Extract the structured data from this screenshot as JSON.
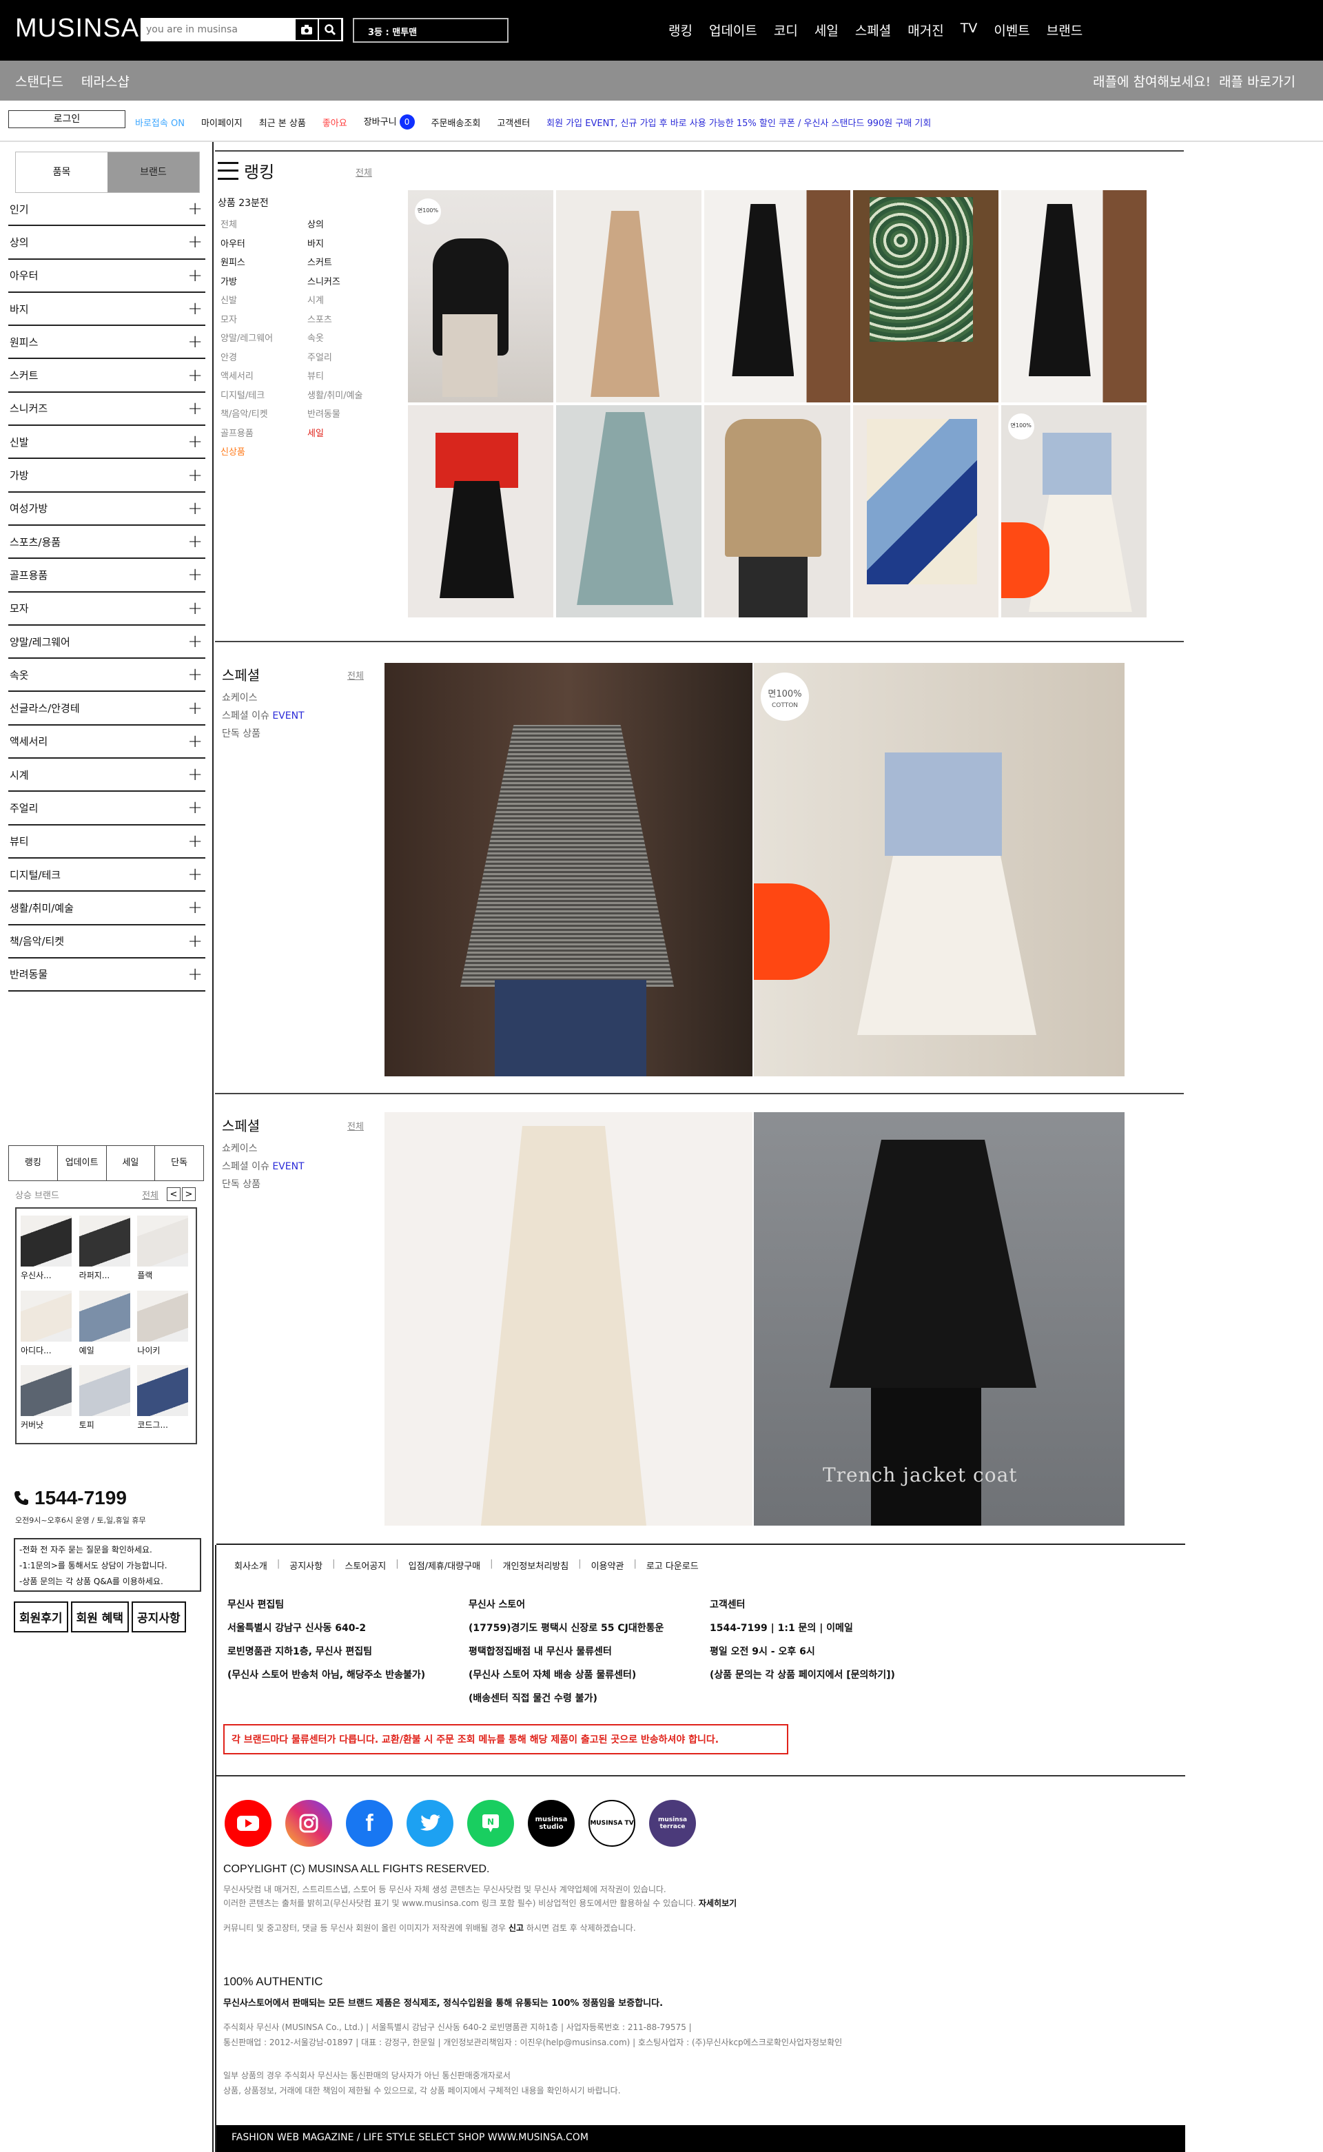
{
  "header": {
    "logo": "MUSINSA",
    "search_placeholder": "you are in musinsa",
    "rank_box": "3등 : 맨투맨",
    "nav": [
      "랭킹",
      "업데이트",
      "코디",
      "세일",
      "스페셜",
      "매거진",
      "TV",
      "이벤트",
      "브랜드"
    ]
  },
  "subbar": {
    "left": [
      "스탠다드",
      "테라스샵"
    ],
    "right": [
      "래플에 참여해보세요!",
      "래플 바로가기"
    ]
  },
  "thirdbar": {
    "login": "로그인",
    "links": [
      "바로접속 ON",
      "마이페이지",
      "최근 본 상품",
      "좋아요",
      "장바구니",
      "주문배송조회",
      "고객센터"
    ],
    "cart_count": "0",
    "promo": "회원 가입 EVENT, 신규 가입 후 바로 사용 가능한 15% 할인 쿠폰 / 우신사 스탠다드 990원 구매 기회"
  },
  "sidebar": {
    "tabs": [
      "품목",
      "브랜드"
    ],
    "categories": [
      "인기",
      "상의",
      "아우터",
      "바지",
      "원피스",
      "스커트",
      "스니커즈",
      "신발",
      "가방",
      "여성가방",
      "스포츠/용품",
      "골프용품",
      "모자",
      "양말/레그웨어",
      "속옷",
      "선글라스/안경테",
      "액세서리",
      "시계",
      "주얼리",
      "뷰티",
      "디지털/테크",
      "생활/취미/예술",
      "책/음악/티켓",
      "반려동물"
    ],
    "mini_tabs": [
      "랭킹",
      "업데이트",
      "세일",
      "단독"
    ],
    "brand_head": "상승 브랜드",
    "brand_all": "전체",
    "brands": [
      "우신사...",
      "라퍼지...",
      "플랙",
      "아디다...",
      "예일",
      "나이키",
      "커버낫",
      "토피",
      "코드그..."
    ],
    "phone": "1544-7199",
    "phone_sub": "오전9시~오후6시 운영 / 토,일,휴일 휴무",
    "qbox": [
      "-전화 전 자주 묻는 질문을 확인하세요.",
      "-1:1문의>를 통해서도 상담이 가능합니다.",
      "-상품 문의는 각 상품 Q&A를 이용하세요."
    ],
    "buttons": [
      "회원후기",
      "회원 혜택",
      "공지사항"
    ]
  },
  "ranking": {
    "title": "랭킹",
    "all": "전체",
    "sub": "상품 23분전",
    "cats_left": [
      "전체",
      "아우터",
      "원피스",
      "가방",
      "신발",
      "모자",
      "양말/레그웨어",
      "안경",
      "액세서리",
      "디지털/테크",
      "책/음악/티켓",
      "골프용품",
      "신상품"
    ],
    "cats_right": [
      "상의",
      "바지",
      "스커트",
      "스니커즈",
      "시계",
      "스포츠",
      "속옷",
      "주얼리",
      "뷰티",
      "생활/취미/예술",
      "반려동물",
      "세일"
    ],
    "cotton_label": "면100%"
  },
  "special1": {
    "title": "스페셜",
    "all": "전체",
    "items": [
      "쇼케이스",
      "스페셜 이슈",
      "EVENT",
      "단독 상품"
    ],
    "cotton": "면100%",
    "cotton_en": "COTTON"
  },
  "special2": {
    "title": "스페셜",
    "all": "전체",
    "items": [
      "쇼케이스",
      "스페셜 이슈",
      "EVENT",
      "단독 상품"
    ],
    "caption": "Trench jacket coat"
  },
  "footer": {
    "links": [
      "회사소개",
      "공지사항",
      "스토어공지",
      "입점/제휴/대량구매",
      "개인정보처리방침",
      "이용약관",
      "로고 다운로드"
    ],
    "col1": [
      "무신사 편집팀",
      "서울특별시 강남구 신사동 640-2",
      "로빈명품관 지하1층, 무신사 편집팀",
      "(무신사 스토어 반송처 아님, 해당주소 반송불가)"
    ],
    "col2": [
      "무신사 스토어",
      "(17759)경기도 평택시 신장로 55 CJ대한통운",
      "평택합정집배점 내 무신사 물류센터",
      "(무신사 스토어 자체 배송 상품 물류센터)",
      "(배송센터 직접 물건 수령 불가)"
    ],
    "col3": [
      "고객센터",
      "1544-7199 | 1:1 문의 | 이메일",
      "평일 오전 9시 - 오후 6시",
      "(상품 문의는 각 상품 페이지에서 [문의하기])"
    ],
    "warning": "각 브랜드마다 물류센터가 다릅니다. 교환/환불 시 주문 조회 메뉴를 통해 해당 제품이 출고된 곳으로 반송하셔야 합니다.",
    "socials": [
      "youtube",
      "instagram",
      "facebook",
      "twitter",
      "naver",
      "musinsa studio",
      "MUSINSA TV",
      "musinsa terrace"
    ],
    "copyright": "COPYLIGHT (C) MUSINSA ALL FIGHTS RESERVED.",
    "notice1": "무신사닷컴 내 매거진, 스트리트스냅, 스토어 등 무신사 자체 생성 콘텐츠는 무신사닷컴 및 무신사 계약업체에 저작권이 있습니다.",
    "notice2": "이러한 콘텐츠는 출처를 밝히고(무신사닷컴 표기 및 www.musinsa.com 링크 포함 필수) 비상업적인 용도에서만 활용하실 수 있습니다.",
    "more": "자세히보기",
    "notice3": "커뮤니티 및 중고장터, 댓글 등 무신사 회원이 올린 이미지가 저작권에 위배될 경우",
    "report": "신고",
    "notice3b": "하시면 검토 후 삭제하겠습니다.",
    "auth_title": "100% AUTHENTIC",
    "auth_sub": "무신사스토어에서 판매되는 모든 브랜드 제품은 정식제조, 정식수입원을 통해 유통되는 100% 정품임을 보증합니다.",
    "company1": "주식회사 무신사 (MUSINSA Co., Ltd.) | 서울특별시 강남구 신사동 640-2 로빈명품관 지하1층 | 사업자등록번호 : 211-88-79575 |",
    "company2": "통신판매업 : 2012-서울강남-01897 | 대표 : 강정구, 한문일 | 개인정보관리책임자 : 이진우(help@musinsa.com)   |   호스팅사업자 : (주)무신사kcp에스크로확인사업자정보확인",
    "company3": "일부 상품의 경우 주식회사 무신사는 통신판매의 당사자가 아닌 통신판매중개자로서",
    "company4": "상품, 상품정보, 거래에 대한 책임이 제한될 수 있으므로, 각 상품 페이지에서 구체적인 내용을 확인하시기 바랍니다.",
    "bottom": "FASHION WEB MAGAZINE / LIFE STYLE SELECT SHOP WWW.MUSINSA.COM"
  }
}
